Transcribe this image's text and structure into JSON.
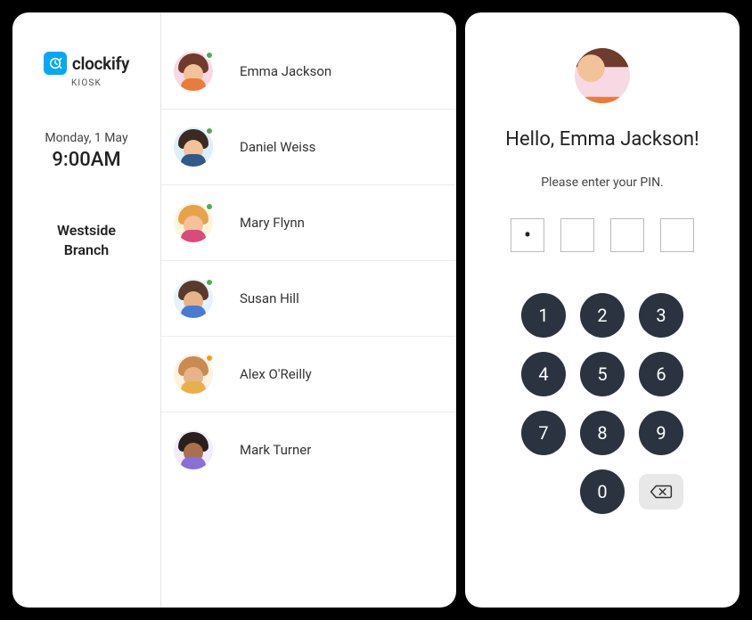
{
  "brand": {
    "name": "clockify",
    "subtitle": "KIOSK"
  },
  "datetime": {
    "date": "Monday, 1 May",
    "time": "9:00AM"
  },
  "location": {
    "name": "Westside Branch"
  },
  "people": [
    {
      "name": "Emma Jackson",
      "status": "green",
      "avatar_bg": "#f7d9e3",
      "hair": "#6e3b2c",
      "skin": "light",
      "torso": "#e97c3a"
    },
    {
      "name": "Daniel Weiss",
      "status": "green",
      "avatar_bg": "#dcefff",
      "hair": "#3a2a22",
      "skin": "light",
      "torso": "#2f5a8a"
    },
    {
      "name": "Mary Flynn",
      "status": "green",
      "avatar_bg": "#fff6de",
      "hair": "#e7a24a",
      "skin": "light",
      "torso": "#d94b7b"
    },
    {
      "name": "Susan Hill",
      "status": "green",
      "avatar_bg": "#e8f1ff",
      "hair": "#5a3a2a",
      "skin": "tan",
      "torso": "#4a7bd4"
    },
    {
      "name": "Alex O'Reilly",
      "status": "orange",
      "avatar_bg": "#fff2de",
      "hair": "#c98b52",
      "skin": "tan",
      "torso": "#e8b04a"
    },
    {
      "name": "Mark Turner",
      "status": "none",
      "avatar_bg": "#f2ecff",
      "hair": "#2a1f1a",
      "skin": "dark",
      "torso": "#8a6fd6"
    }
  ],
  "pin_screen": {
    "greeting_prefix": "Hello, ",
    "greeting_name": "Emma Jackson",
    "greeting_suffix": "!",
    "prompt": "Please enter your PIN.",
    "entered_count": 1,
    "total_digits": 4,
    "selected_avatar_bg": "#f7d9e3",
    "selected_hair": "#6e3b2c",
    "selected_torso": "#e97c3a"
  },
  "keypad": {
    "keys": [
      "1",
      "2",
      "3",
      "4",
      "5",
      "6",
      "7",
      "8",
      "9",
      "",
      "0",
      "back"
    ]
  }
}
